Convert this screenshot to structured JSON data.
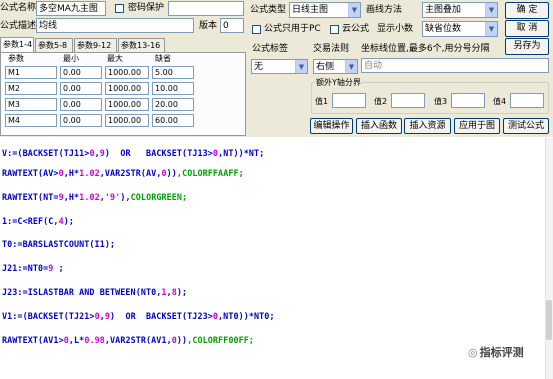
{
  "form": {
    "name_label": "公式名称",
    "name_value": "多空MA九主图",
    "password_label": "密码保护",
    "desc_label": "公式描述",
    "desc_value": "均线",
    "version_label": "版本",
    "version_value": "0",
    "type_label": "公式类型",
    "type_value": "日线主图",
    "draw_label": "画线方法",
    "draw_value": "主图叠加",
    "pc_label": "公式只用于PC",
    "cloud_label": "云公式",
    "decimals_label": "显示小数",
    "decimals_value": "缺省位数",
    "ok_label": "确  定",
    "cancel_label": "取  消",
    "saveas_label": "另存为"
  },
  "tabs": [
    "参数1-4",
    "参数5-8",
    "参数9-12",
    "参数13-16"
  ],
  "params": {
    "headers": [
      "参数",
      "最小",
      "最大",
      "缺省"
    ],
    "rows": [
      [
        "M1",
        "0.00",
        "1000.00",
        "5.00"
      ],
      [
        "M2",
        "0.00",
        "1000.00",
        "10.00"
      ],
      [
        "M3",
        "0.00",
        "1000.00",
        "20.00"
      ],
      [
        "M4",
        "0.00",
        "1000.00",
        "60.00"
      ]
    ]
  },
  "right_panel": {
    "formula_label_label": "公式标签",
    "formula_label_value": "无",
    "trade_label": "交易法则",
    "coord_label": "坐标线位置,最多6个,用分号分隔",
    "axis_value": "右侧",
    "auto_value": "自动",
    "extra_y_label": "额外Y轴分界",
    "values": [
      "值1",
      "值2",
      "值3",
      "值4"
    ]
  },
  "buttons": [
    "编辑操作",
    "插入函数",
    "插入资源",
    "应用于图",
    "测试公式"
  ],
  "code_lines": [
    [
      [
        "V:=(",
        "k"
      ],
      [
        "BACKSET",
        "k"
      ],
      [
        "(TJ11>",
        "k"
      ],
      [
        "0",
        "n"
      ],
      [
        ",",
        "k"
      ],
      [
        "9",
        "n"
      ],
      [
        ")  OR   ",
        "k"
      ],
      [
        "BACKSET",
        "k"
      ],
      [
        "(TJ13>",
        "k"
      ],
      [
        "0",
        "n"
      ],
      [
        ",NT))*NT;",
        "k"
      ]
    ],
    [
      [
        "RAWTEXT(AV>",
        "k"
      ],
      [
        "0",
        "n"
      ],
      [
        ",H*",
        "k"
      ],
      [
        "1.02",
        "n"
      ],
      [
        ",VAR2STR(AV,",
        "k"
      ],
      [
        "0",
        "n"
      ],
      [
        "))",
        "k"
      ],
      [
        ",COLORFFAAFF;",
        "s"
      ]
    ],
    [
      [
        "RAWTEXT(NT=",
        "k"
      ],
      [
        "9",
        "n"
      ],
      [
        ",H*",
        "k"
      ],
      [
        "1.02",
        "n"
      ],
      [
        ",",
        "k"
      ],
      [
        "'9'",
        "n"
      ],
      [
        "),",
        "k"
      ],
      [
        "COLORGREEN;",
        "s"
      ]
    ],
    [
      [
        "1:=C<REF(C,",
        "k"
      ],
      [
        "4",
        "n"
      ],
      [
        ");",
        "k"
      ]
    ],
    [
      [
        "T0:=BARSLASTCOUNT(I1);",
        "k"
      ]
    ],
    [
      [
        "J21:=NT0=",
        "k"
      ],
      [
        "9",
        "n"
      ],
      [
        " ;",
        "k"
      ]
    ],
    [
      [
        "J23:=ISLASTBAR AND BETWEEN(NT0,",
        "k"
      ],
      [
        "1",
        "n"
      ],
      [
        ",",
        "k"
      ],
      [
        "8",
        "n"
      ],
      [
        ");",
        "k"
      ]
    ],
    [
      [
        "V1:=(BACKSET(TJ21>",
        "k"
      ],
      [
        "0",
        "n"
      ],
      [
        ",",
        "k"
      ],
      [
        "9",
        "n"
      ],
      [
        ")  OR  BACKSET(TJ23>",
        "k"
      ],
      [
        "0",
        "n"
      ],
      [
        ",NT0))*NT0;",
        "k"
      ]
    ],
    [
      [
        "RAWTEXT(AV1>",
        "k"
      ],
      [
        "0",
        "n"
      ],
      [
        ",L*",
        "k"
      ],
      [
        "0.98",
        "n"
      ],
      [
        ",VAR2STR(AV1,",
        "k"
      ],
      [
        "0",
        "n"
      ],
      [
        "))",
        "k"
      ],
      [
        ",COLORFF00FF;",
        "s"
      ]
    ]
  ],
  "watermark": "指标评测"
}
